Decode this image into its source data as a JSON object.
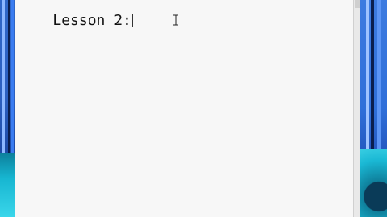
{
  "editor": {
    "text": "Lesson 2:"
  },
  "icons": {
    "cursor": "ibeam-cursor-icon"
  },
  "colors": {
    "editor_bg": "#f7f7f7",
    "desktop_blue": "#2f6fd9",
    "desktop_teal": "#17b6d1"
  }
}
